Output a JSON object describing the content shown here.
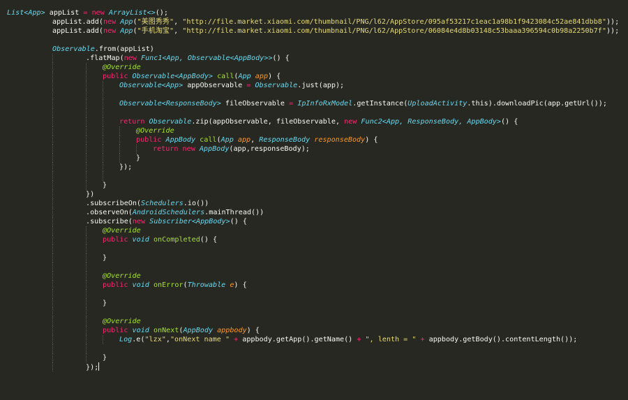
{
  "theme": {
    "background": "#272822",
    "keyword": "#F92672",
    "type": "#66D9EF",
    "function": "#A6E22E",
    "string": "#E6DB74",
    "parameter": "#FD971F",
    "text": "#F8F8F2"
  },
  "code_lines": [
    {
      "indent": 0,
      "tokens": [
        [
          "ty",
          "List<App>"
        ],
        [
          "tx",
          " appList "
        ],
        [
          "kw",
          "="
        ],
        [
          "tx",
          " "
        ],
        [
          "kw",
          "new"
        ],
        [
          "tx",
          " "
        ],
        [
          "ty",
          "ArrayList<>"
        ],
        [
          "tx",
          "();"
        ]
      ]
    },
    {
      "indent": 1,
      "tokens": [
        [
          "tx",
          "appList.add("
        ],
        [
          "kw",
          "new"
        ],
        [
          "tx",
          " "
        ],
        [
          "ty",
          "App"
        ],
        [
          "tx",
          "("
        ],
        [
          "st",
          "\"美图秀秀\""
        ],
        [
          "tx",
          ", "
        ],
        [
          "st",
          "\"http://file.market.xiaomi.com/thumbnail/PNG/l62/AppStore/095af53217c1eac1a98b1f9423084c52ae841dbb8\""
        ],
        [
          "tx",
          "));"
        ]
      ]
    },
    {
      "indent": 1,
      "tokens": [
        [
          "tx",
          "appList.add("
        ],
        [
          "kw",
          "new"
        ],
        [
          "tx",
          " "
        ],
        [
          "ty",
          "App"
        ],
        [
          "tx",
          "("
        ],
        [
          "st",
          "\"手机淘宝\""
        ],
        [
          "tx",
          ", "
        ],
        [
          "st",
          "\"http://file.market.xiaomi.com/thumbnail/PNG/l62/AppStore/06084e4d8b03148c53baaa396594c0b98a2250b7f\""
        ],
        [
          "tx",
          "));"
        ]
      ]
    },
    {
      "indent": 0,
      "tokens": []
    },
    {
      "indent": 1,
      "tokens": [
        [
          "ty",
          "Observable"
        ],
        [
          "tx",
          ".from(appList)"
        ]
      ]
    },
    {
      "indent": 3,
      "tokens": [
        [
          "tx",
          ".flatMap("
        ],
        [
          "kw",
          "new"
        ],
        [
          "tx",
          " "
        ],
        [
          "ty",
          "Func1<App, Observable<AppBody>>"
        ],
        [
          "tx",
          "() {"
        ]
      ]
    },
    {
      "indent": 4,
      "tokens": [
        [
          "an",
          "@Override"
        ]
      ]
    },
    {
      "indent": 4,
      "tokens": [
        [
          "kw",
          "public"
        ],
        [
          "tx",
          " "
        ],
        [
          "ty",
          "Observable<AppBody>"
        ],
        [
          "tx",
          " "
        ],
        [
          "fn",
          "call"
        ],
        [
          "tx",
          "("
        ],
        [
          "ty",
          "App"
        ],
        [
          "tx",
          " "
        ],
        [
          "pa",
          "app"
        ],
        [
          "tx",
          ") {"
        ]
      ]
    },
    {
      "indent": 5,
      "tokens": [
        [
          "ty",
          "Observable<App>"
        ],
        [
          "tx",
          " appObservable "
        ],
        [
          "kw",
          "="
        ],
        [
          "tx",
          " "
        ],
        [
          "ty",
          "Observable"
        ],
        [
          "tx",
          ".just(app);"
        ]
      ]
    },
    {
      "indent": 5,
      "tokens": []
    },
    {
      "indent": 5,
      "tokens": [
        [
          "ty",
          "Observable<ResponseBody>"
        ],
        [
          "tx",
          " fileObservable "
        ],
        [
          "kw",
          "="
        ],
        [
          "tx",
          " "
        ],
        [
          "ty",
          "IpInfoRxModel"
        ],
        [
          "tx",
          ".getInstance("
        ],
        [
          "ty",
          "UploadActivity"
        ],
        [
          "tx",
          ".this).downloadPic(app.getUrl());"
        ]
      ]
    },
    {
      "indent": 5,
      "tokens": []
    },
    {
      "indent": 5,
      "tokens": [
        [
          "kw",
          "return"
        ],
        [
          "tx",
          " "
        ],
        [
          "ty",
          "Observable"
        ],
        [
          "tx",
          ".zip(appObservable, fileObservable, "
        ],
        [
          "kw",
          "new"
        ],
        [
          "tx",
          " "
        ],
        [
          "ty",
          "Func2<App, ResponseBody, AppBody>"
        ],
        [
          "tx",
          "() {"
        ]
      ]
    },
    {
      "indent": 6,
      "tokens": [
        [
          "an",
          "@Override"
        ]
      ]
    },
    {
      "indent": 6,
      "tokens": [
        [
          "kw",
          "public"
        ],
        [
          "tx",
          " "
        ],
        [
          "ty",
          "AppBody"
        ],
        [
          "tx",
          " "
        ],
        [
          "fn",
          "call"
        ],
        [
          "tx",
          "("
        ],
        [
          "ty",
          "App"
        ],
        [
          "tx",
          " "
        ],
        [
          "pa",
          "app"
        ],
        [
          "tx",
          ", "
        ],
        [
          "ty",
          "ResponseBody"
        ],
        [
          "tx",
          " "
        ],
        [
          "pa",
          "responseBody"
        ],
        [
          "tx",
          ") {"
        ]
      ]
    },
    {
      "indent": 7,
      "tokens": [
        [
          "kw",
          "return"
        ],
        [
          "tx",
          " "
        ],
        [
          "kw",
          "new"
        ],
        [
          "tx",
          " "
        ],
        [
          "ty",
          "AppBody"
        ],
        [
          "tx",
          "(app,responseBody);"
        ]
      ]
    },
    {
      "indent": 6,
      "tokens": [
        [
          "tx",
          "}"
        ]
      ]
    },
    {
      "indent": 5,
      "tokens": [
        [
          "tx",
          "});"
        ]
      ]
    },
    {
      "indent": 5,
      "tokens": []
    },
    {
      "indent": 4,
      "tokens": [
        [
          "tx",
          "}"
        ]
      ]
    },
    {
      "indent": 3,
      "tokens": [
        [
          "tx",
          "})"
        ]
      ]
    },
    {
      "indent": 3,
      "tokens": [
        [
          "tx",
          ".subscribeOn("
        ],
        [
          "ty",
          "Schedulers"
        ],
        [
          "tx",
          ".io())"
        ]
      ]
    },
    {
      "indent": 3,
      "tokens": [
        [
          "tx",
          ".observeOn("
        ],
        [
          "ty",
          "AndroidSchedulers"
        ],
        [
          "tx",
          ".mainThread())"
        ]
      ]
    },
    {
      "indent": 3,
      "tokens": [
        [
          "tx",
          ".subscribe("
        ],
        [
          "kw",
          "new"
        ],
        [
          "tx",
          " "
        ],
        [
          "ty",
          "Subscriber<AppBody>"
        ],
        [
          "tx",
          "() {"
        ]
      ]
    },
    {
      "indent": 4,
      "tokens": [
        [
          "an",
          "@Override"
        ]
      ]
    },
    {
      "indent": 4,
      "tokens": [
        [
          "kw",
          "public"
        ],
        [
          "tx",
          " "
        ],
        [
          "ty",
          "void"
        ],
        [
          "tx",
          " "
        ],
        [
          "fn",
          "onCompleted"
        ],
        [
          "tx",
          "() {"
        ]
      ]
    },
    {
      "indent": 4,
      "tokens": []
    },
    {
      "indent": 4,
      "tokens": [
        [
          "tx",
          "}"
        ]
      ]
    },
    {
      "indent": 4,
      "tokens": []
    },
    {
      "indent": 4,
      "tokens": [
        [
          "an",
          "@Override"
        ]
      ]
    },
    {
      "indent": 4,
      "tokens": [
        [
          "kw",
          "public"
        ],
        [
          "tx",
          " "
        ],
        [
          "ty",
          "void"
        ],
        [
          "tx",
          " "
        ],
        [
          "fn",
          "onError"
        ],
        [
          "tx",
          "("
        ],
        [
          "ty",
          "Throwable"
        ],
        [
          "tx",
          " "
        ],
        [
          "pa",
          "e"
        ],
        [
          "tx",
          ") {"
        ]
      ]
    },
    {
      "indent": 4,
      "tokens": []
    },
    {
      "indent": 4,
      "tokens": [
        [
          "tx",
          "}"
        ]
      ]
    },
    {
      "indent": 4,
      "tokens": []
    },
    {
      "indent": 4,
      "tokens": [
        [
          "an",
          "@Override"
        ]
      ]
    },
    {
      "indent": 4,
      "tokens": [
        [
          "kw",
          "public"
        ],
        [
          "tx",
          " "
        ],
        [
          "ty",
          "void"
        ],
        [
          "tx",
          " "
        ],
        [
          "fn",
          "onNext"
        ],
        [
          "tx",
          "("
        ],
        [
          "ty",
          "AppBody"
        ],
        [
          "tx",
          " "
        ],
        [
          "pa",
          "appbody"
        ],
        [
          "tx",
          ") {"
        ]
      ]
    },
    {
      "indent": 5,
      "tokens": [
        [
          "ty",
          "Log"
        ],
        [
          "tx",
          ".e("
        ],
        [
          "st",
          "\"lzx\""
        ],
        [
          "tx",
          ","
        ],
        [
          "st",
          "\"onNext name \""
        ],
        [
          "tx",
          " "
        ],
        [
          "kw",
          "+"
        ],
        [
          "tx",
          " appbody.getApp().getName() "
        ],
        [
          "kw",
          "+"
        ],
        [
          "tx",
          " "
        ],
        [
          "st",
          "\", lenth = \""
        ],
        [
          "tx",
          " "
        ],
        [
          "kw",
          "+"
        ],
        [
          "tx",
          " appbody.getBody().contentLength());"
        ]
      ]
    },
    {
      "indent": 4,
      "tokens": []
    },
    {
      "indent": 4,
      "tokens": [
        [
          "tx",
          "}"
        ]
      ]
    },
    {
      "indent": 3,
      "tokens": [
        [
          "tx",
          "});"
        ]
      ],
      "cursor": true
    }
  ]
}
